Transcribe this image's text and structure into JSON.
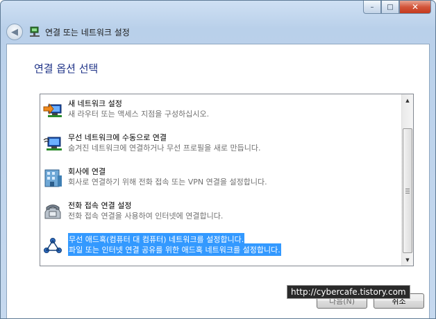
{
  "window": {
    "title": "연결 또는 네트워크 설정",
    "caption_buttons": {
      "minimize": "–",
      "maximize": "□",
      "close": "✕"
    }
  },
  "nav": {
    "back_icon": "back-arrow-icon",
    "app_icon": "network-setup-icon"
  },
  "page": {
    "heading": "연결 옵션 선택"
  },
  "options": [
    {
      "title": "새 네트워크 설정",
      "description": "새 라우터 또는 액세스 지점을 구성하십시오.",
      "icon": "new-network-icon",
      "selected": false
    },
    {
      "title": "무선 네트워크에 수동으로 연결",
      "description": "숨겨진 네트워크에 연결하거나 무선 프로필을 새로 만듭니다.",
      "icon": "wireless-network-icon",
      "selected": false
    },
    {
      "title": "회사에 연결",
      "description": "회사로 연결하기 위해 전화 접속 또는 VPN 연결을 설정합니다.",
      "icon": "workplace-building-icon",
      "selected": false
    },
    {
      "title": "전화 접속 연결 설정",
      "description": "전화 접속 연결을 사용하여 인터넷에 연결합니다.",
      "icon": "dialup-phone-icon",
      "selected": false
    },
    {
      "title": "무선 애드혹(컴퓨터 대 컴퓨터) 네트워크를 설정합니다.",
      "description": "파일 또는 인터넷 연결 공유를 위한 애드혹 네트워크를 설정합니다.",
      "icon": "adhoc-network-icon",
      "selected": true
    }
  ],
  "buttons": {
    "next": "다음(N)",
    "cancel": "취소"
  },
  "watermark": "http://cybercafe.tistory.com",
  "colors": {
    "selection": "#3399ff",
    "heading": "#1e3287"
  }
}
